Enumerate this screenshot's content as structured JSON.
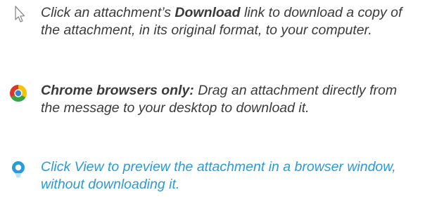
{
  "tips": [
    {
      "icon": "mouse-pointer-icon",
      "pre": "Click an attachment’s ",
      "bold": "Download",
      "post": " link to download a copy of the attachment, in its original format, to your computer."
    },
    {
      "icon": "chrome-logo-icon",
      "bold": "Chrome browsers only:",
      "post": " Drag an attachment directly from the message to your desktop to download it."
    },
    {
      "icon": "view-bulb-icon",
      "text": "Click View to preview the attachment in a browser window, without downloading it.",
      "color": "#2a9ad8"
    }
  ]
}
